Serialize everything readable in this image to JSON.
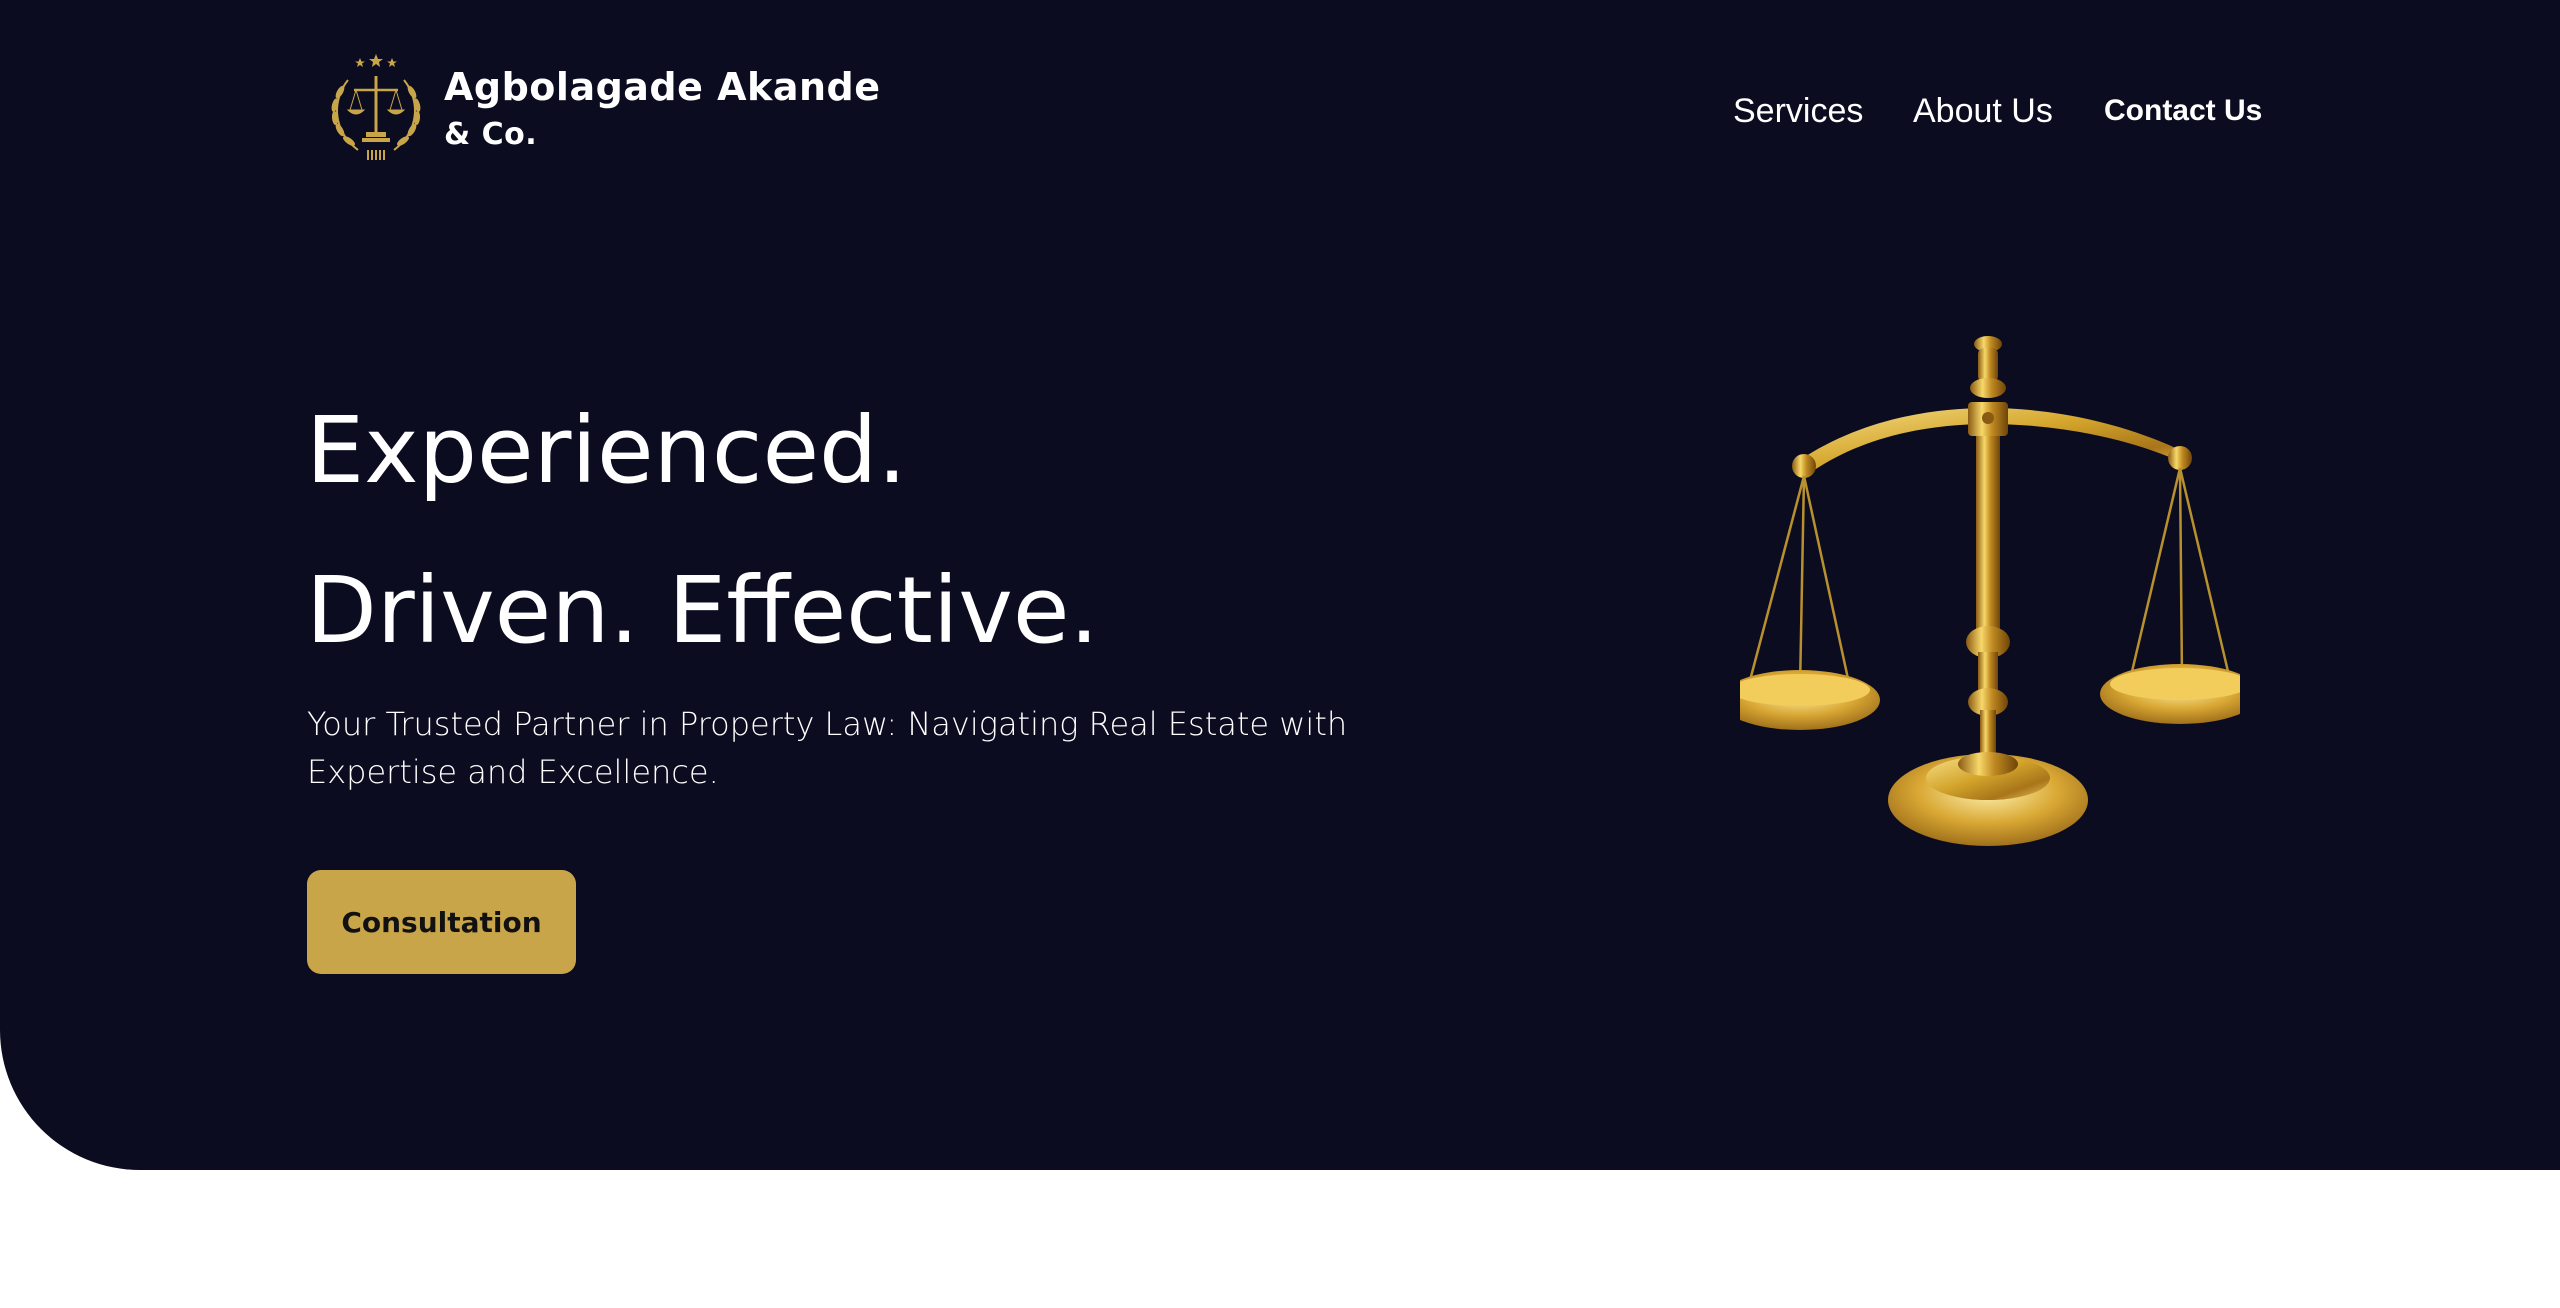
{
  "brand": {
    "name_line1": "Agbolagade Akande",
    "name_line2": "& Co.",
    "logo_icon": "scales-of-justice-laurel-icon"
  },
  "nav": {
    "items": [
      {
        "label": "Services"
      },
      {
        "label": "About Us"
      },
      {
        "label": "Contact Us"
      }
    ]
  },
  "hero": {
    "headline_line1": "Experienced.",
    "headline_line2": "Driven. Effective.",
    "subtitle": "Your Trusted Partner in Property Law: Navigating Real Estate with Expertise and Excellence.",
    "cta_label": "Consultation",
    "illustration": "gold-scales-of-justice-image"
  },
  "colors": {
    "background_dark": "#0b0c20",
    "accent_gold": "#c9a54a",
    "text_light": "#ffffff",
    "page_bg": "#ffffff"
  }
}
